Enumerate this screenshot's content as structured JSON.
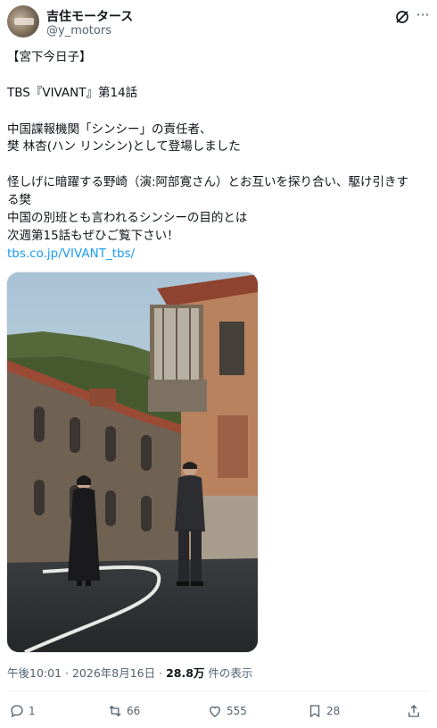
{
  "author": {
    "display_name": "吉住モータース",
    "handle": "@y_motors"
  },
  "tweet": {
    "lines": [
      "【宮下今日子】",
      "TBS『VIVANT』第14話",
      "中国諜報機関「シンシー」の責任者、",
      "樊 林杏(ハン リンシン)として登場しました",
      "怪しげに暗躍する野崎（演:阿部寛さん）とお互いを探り合い、駆け引きす",
      "る樊",
      "中国の別班とも言われるシンシーの目的とは",
      "次週第15話もぜひご覧下さい！"
    ],
    "link": "tbs.co.jp/VIVANT_tbs/"
  },
  "meta": {
    "time": "午後10:01",
    "date": "2026年8月16日",
    "views": "28.8万",
    "views_label": "件の表示"
  },
  "actions": {
    "replies": "1",
    "reposts": "66",
    "likes": "555",
    "bookmarks": "28"
  },
  "icons": {
    "grok": "grok-icon",
    "more": "more-icon",
    "reply": "reply-icon",
    "repost": "repost-icon",
    "like": "heart-icon",
    "bookmark": "bookmark-icon",
    "share": "share-icon"
  },
  "colors": {
    "link": "#1d9bf0",
    "secondary_text": "#536471"
  }
}
